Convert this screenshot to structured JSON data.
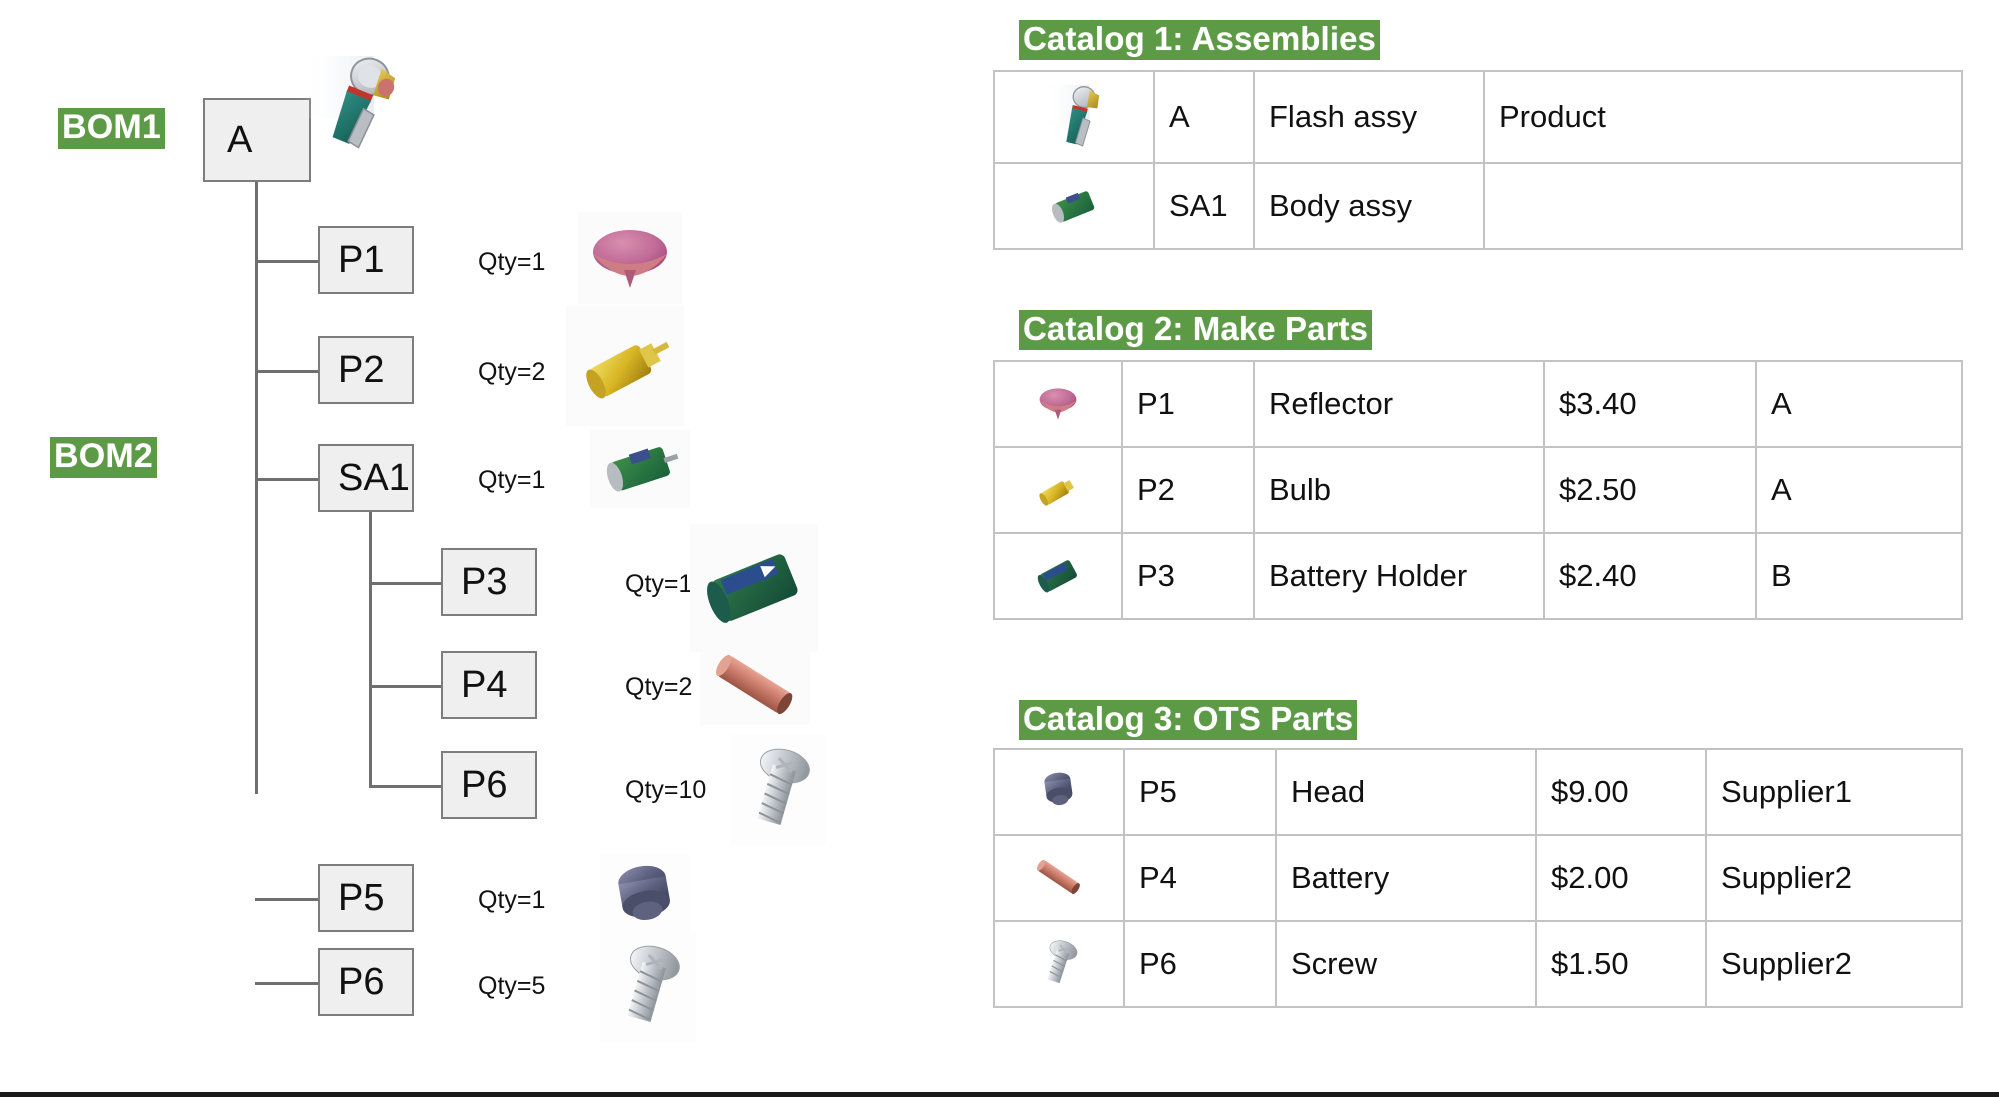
{
  "diagram": {
    "title_labels": {
      "bom1": "BOM1",
      "bom2": "BOM2"
    },
    "accent_green": "#5c9a46",
    "node_fill": "#efefef",
    "node_border": "#7d7d7d",
    "connector_color": "#6f6f6f",
    "table_border": "#c3c3c3"
  },
  "tree": {
    "root": {
      "id": "A",
      "qty": "",
      "thumb": "flashlight-assembly-icon"
    },
    "level1": [
      {
        "id": "P1",
        "qty": "Qty=1",
        "thumb": "reflector-icon"
      },
      {
        "id": "P2",
        "qty": "Qty=2",
        "thumb": "bulb-icon"
      },
      {
        "id": "SA1",
        "qty": "Qty=1",
        "thumb": "body-assembly-icon"
      },
      {
        "id": "P5",
        "qty": "Qty=1",
        "thumb": "head-icon"
      },
      {
        "id": "P6",
        "qty": "Qty=5",
        "thumb": "screw-icon"
      }
    ],
    "level2": [
      {
        "id": "P3",
        "qty": "Qty=1",
        "thumb": "battery-holder-icon"
      },
      {
        "id": "P4",
        "qty": "Qty=2",
        "thumb": "battery-icon"
      },
      {
        "id": "P6",
        "qty": "Qty=10",
        "thumb": "screw-icon"
      }
    ]
  },
  "catalogs": [
    {
      "title": "Catalog 1: Assemblies",
      "rows": [
        {
          "thumb": "flashlight-assembly-icon",
          "id": "A",
          "name": "Flash assy",
          "extra": "Product"
        },
        {
          "thumb": "body-assembly-icon",
          "id": "SA1",
          "name": "Body assy",
          "extra": ""
        }
      ]
    },
    {
      "title": "Catalog 2: Make Parts",
      "rows": [
        {
          "thumb": "reflector-icon",
          "id": "P1",
          "name": "Reflector",
          "price": "$3.40",
          "extra": "A"
        },
        {
          "thumb": "bulb-icon",
          "id": "P2",
          "name": "Bulb",
          "price": "$2.50",
          "extra": "A"
        },
        {
          "thumb": "battery-holder-icon",
          "id": "P3",
          "name": "Battery Holder",
          "price": "$2.40",
          "extra": "B"
        }
      ]
    },
    {
      "title": "Catalog 3: OTS Parts",
      "rows": [
        {
          "thumb": "head-icon",
          "id": "P5",
          "name": "Head",
          "price": "$9.00",
          "extra": "Supplier1"
        },
        {
          "thumb": "battery-icon",
          "id": "P4",
          "name": "Battery",
          "price": "$2.00",
          "extra": "Supplier2"
        },
        {
          "thumb": "screw-icon",
          "id": "P6",
          "name": "Screw",
          "price": "$1.50",
          "extra": "Supplier2"
        }
      ]
    }
  ]
}
